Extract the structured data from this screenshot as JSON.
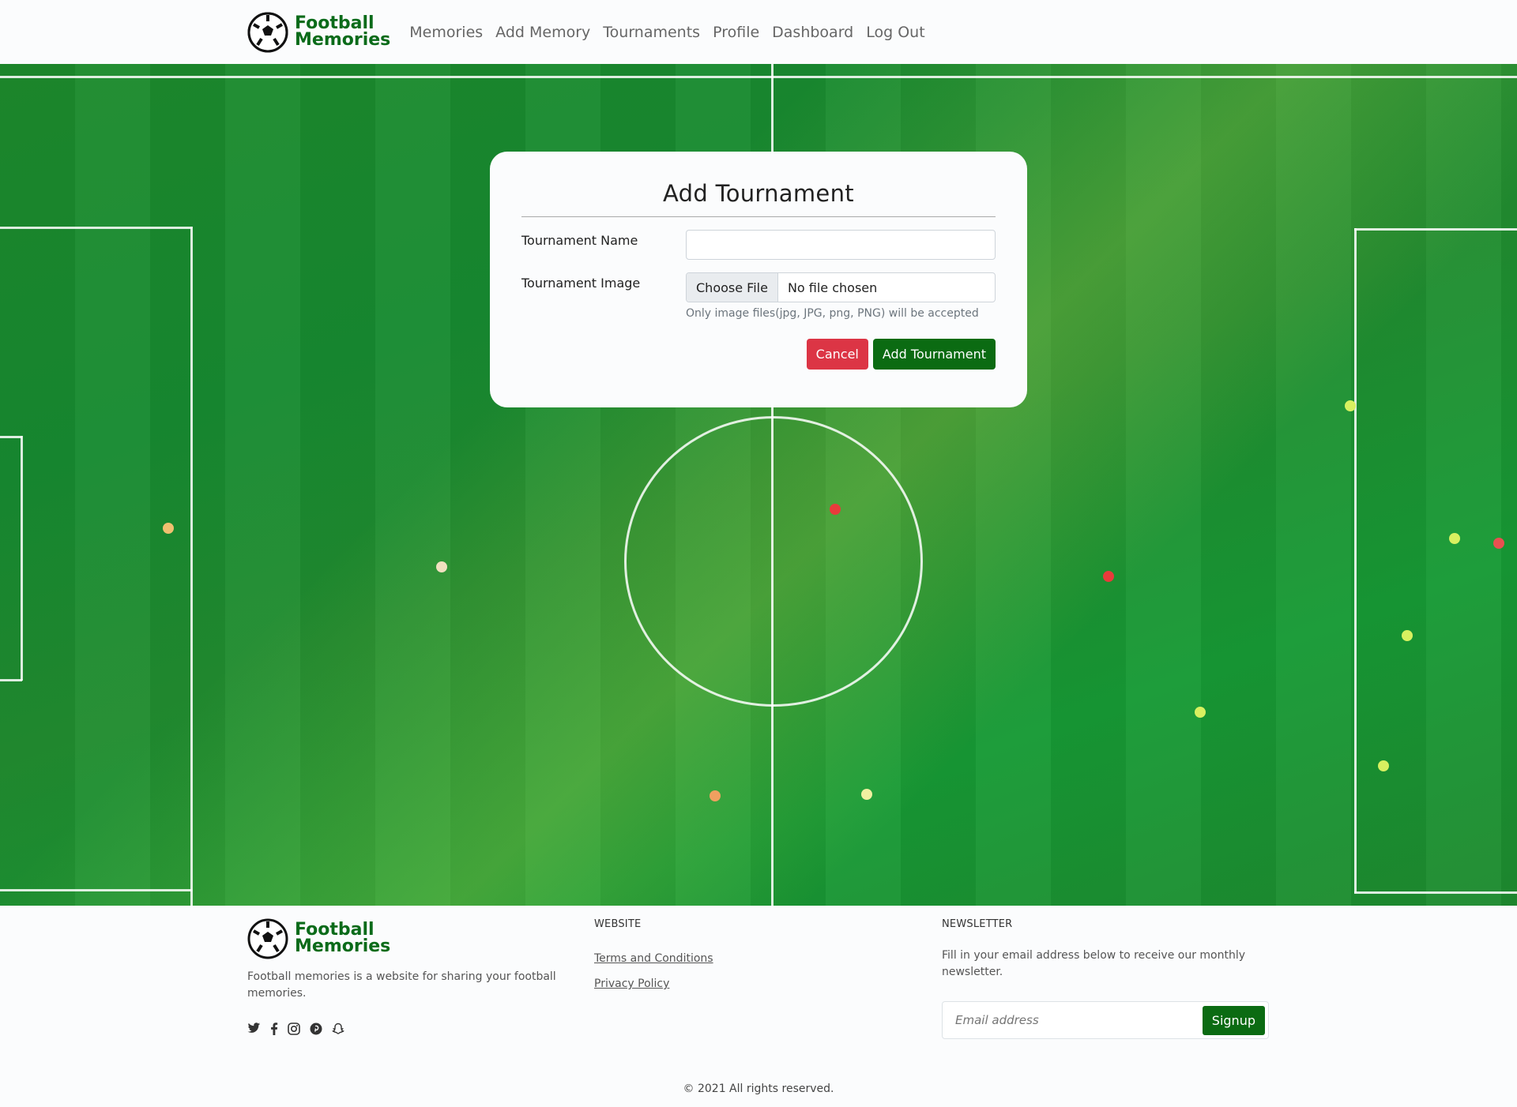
{
  "brand": {
    "line1": "Football",
    "line2": "Memories"
  },
  "nav": {
    "items": [
      {
        "label": "Memories"
      },
      {
        "label": "Add Memory"
      },
      {
        "label": "Tournaments"
      },
      {
        "label": "Profile"
      },
      {
        "label": "Dashboard"
      },
      {
        "label": "Log Out"
      }
    ]
  },
  "form": {
    "title": "Add Tournament",
    "name_label": "Tournament Name",
    "name_value": "",
    "image_label": "Tournament Image",
    "file_button": "Choose File",
    "file_status": "No file chosen",
    "hint": "Only image files(jpg, JPG, png, PNG) will be accepted",
    "cancel": "Cancel",
    "submit": "Add Tournament"
  },
  "footer": {
    "about": "Football memories is a website for sharing your football memories.",
    "website_heading": "WEBSITE",
    "links": [
      "Terms and Conditions",
      "Privacy Policy"
    ],
    "newsletter_heading": "NEWSLETTER",
    "newsletter_text": "Fill in your email address below to receive our monthly newsletter.",
    "email_placeholder": "Email address",
    "signup": "Signup",
    "copyright": "© 2021 All rights reserved."
  },
  "colors": {
    "brand_green": "#0b6b12",
    "danger": "#dc3545"
  },
  "icons": [
    "twitter-icon",
    "facebook-icon",
    "instagram-icon",
    "pinterest-icon",
    "snapchat-icon"
  ]
}
